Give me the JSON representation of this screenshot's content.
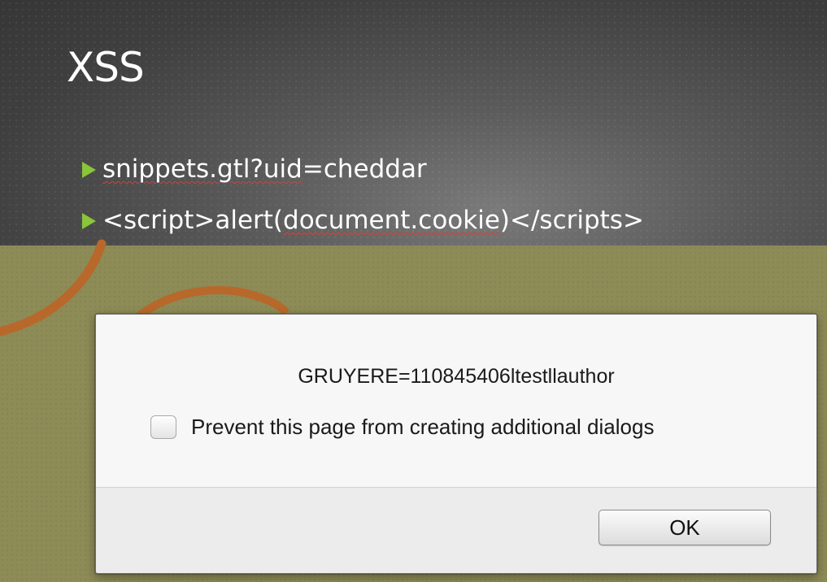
{
  "slide": {
    "title": "XSS",
    "bullets": [
      {
        "parts": [
          "",
          "snippets.gtl?uid",
          "=cheddar"
        ]
      },
      {
        "parts": [
          "<script>alert(",
          "document.cookie",
          ")</scripts>"
        ]
      }
    ]
  },
  "dialog": {
    "message": "GRUYERE=110845406ltestllauthor",
    "checkbox_label": "Prevent this page from creating additional dialogs",
    "checkbox_checked": false,
    "ok_label": "OK"
  },
  "colors": {
    "bullet_accent": "#8ac53a",
    "olive_background": "#8d8b56",
    "ring": "#b8682a"
  }
}
